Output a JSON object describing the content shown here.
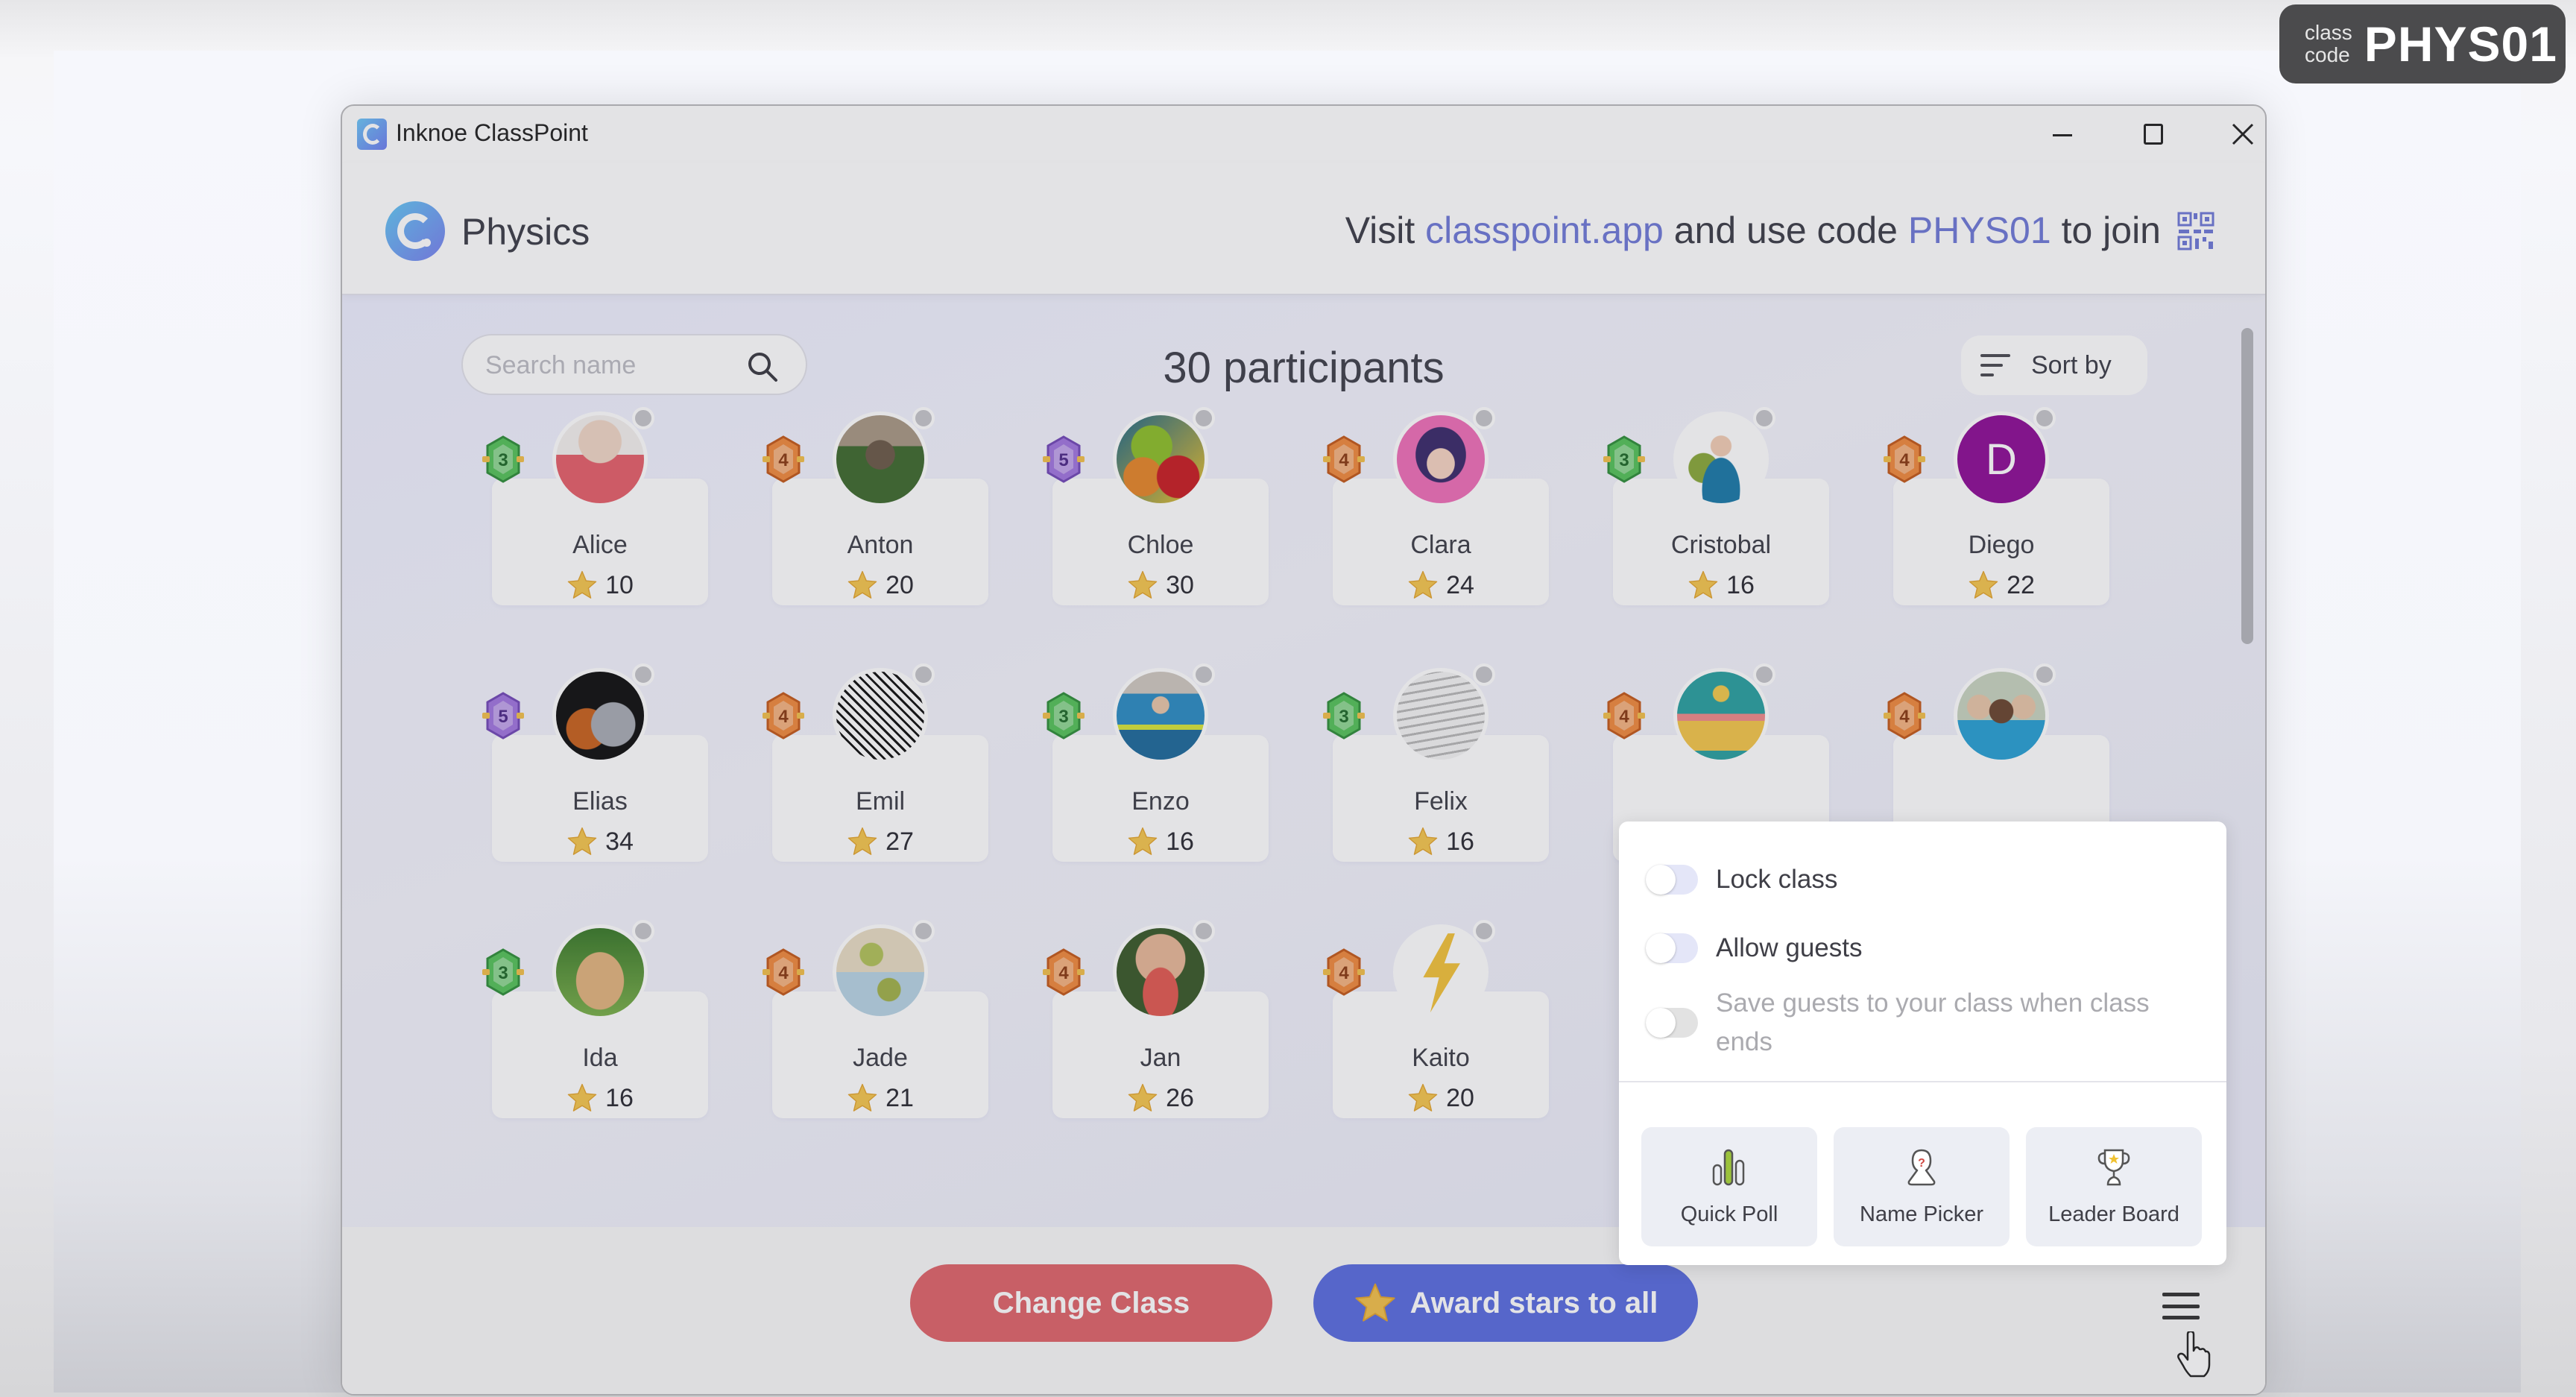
{
  "class_code_badge": {
    "label_line1": "class",
    "label_line2": "code",
    "code": "PHYS01"
  },
  "window": {
    "title": "Inknoe ClassPoint",
    "controls": {
      "minimize": "minimize",
      "maximize": "maximize",
      "close": "close"
    }
  },
  "header": {
    "class_name": "Physics",
    "join_prefix": "Visit",
    "join_url": "classpoint.app",
    "join_middle": "and use code",
    "join_code": "PHYS01",
    "join_suffix": "to join",
    "accent_color": "#6f79d8"
  },
  "toolbar": {
    "search_placeholder": "Search name",
    "search_value": "",
    "participant_count": "30 participants",
    "sort_label": "Sort by"
  },
  "participants": [
    {
      "name": "Alice",
      "stars": "10",
      "level": "3",
      "level_color": "green",
      "avatar": "photo-girl-red-jacket"
    },
    {
      "name": "Anton",
      "stars": "20",
      "level": "4",
      "level_color": "orange",
      "avatar": "photo-llama"
    },
    {
      "name": "Chloe",
      "stars": "30",
      "level": "5",
      "level_color": "purple",
      "avatar": "fruit-illustration"
    },
    {
      "name": "Clara",
      "stars": "24",
      "level": "4",
      "level_color": "orange",
      "avatar": "girl-illustration-pink"
    },
    {
      "name": "Cristobal",
      "stars": "16",
      "level": "3",
      "level_color": "green",
      "avatar": "man-with-plant-illustration"
    },
    {
      "name": "Diego",
      "stars": "22",
      "level": "4",
      "level_color": "orange",
      "avatar": "initial-D",
      "initial": "D"
    },
    {
      "name": "Elias",
      "stars": "34",
      "level": "5",
      "level_color": "purple",
      "avatar": "football-helmet"
    },
    {
      "name": "Emil",
      "stars": "27",
      "level": "4",
      "level_color": "orange",
      "avatar": "sketch-drawing"
    },
    {
      "name": "Enzo",
      "stars": "16",
      "level": "3",
      "level_color": "green",
      "avatar": "photo-child-snow-jacket"
    },
    {
      "name": "Felix",
      "stars": "16",
      "level": "3",
      "level_color": "green",
      "avatar": "tabby-cat-illustration"
    },
    {
      "name": "",
      "stars": "",
      "level": "4",
      "level_color": "orange",
      "avatar": "backpack-illustration"
    },
    {
      "name": "",
      "stars": "",
      "level": "4",
      "level_color": "orange",
      "avatar": "photo-children-group"
    },
    {
      "name": "Ida",
      "stars": "16",
      "level": "3",
      "level_color": "green",
      "avatar": "photo-golden-retriever"
    },
    {
      "name": "Jade",
      "stars": "21",
      "level": "4",
      "level_color": "orange",
      "avatar": "plant-illustration"
    },
    {
      "name": "Jan",
      "stars": "26",
      "level": "4",
      "level_color": "orange",
      "avatar": "photo-child-watermelon"
    },
    {
      "name": "Kaito",
      "stars": "20",
      "level": "4",
      "level_color": "orange",
      "avatar": "lightning-bolt"
    }
  ],
  "settings_menu": {
    "toggles": [
      {
        "label": "Lock class",
        "on": false,
        "enabled": true
      },
      {
        "label": "Allow guests",
        "on": false,
        "enabled": true
      },
      {
        "label": "Save guests to your class when class ends",
        "on": false,
        "enabled": false
      }
    ],
    "tools": [
      {
        "label": "Quick Poll",
        "icon": "bar-chart-icon"
      },
      {
        "label": "Name Picker",
        "icon": "mystery-person-icon"
      },
      {
        "label": "Leader Board",
        "icon": "trophy-icon"
      }
    ]
  },
  "footer": {
    "change_class_label": "Change Class",
    "award_stars_label": "Award stars to all",
    "change_class_color": "#e0646a",
    "award_color": "#5a6de0"
  }
}
